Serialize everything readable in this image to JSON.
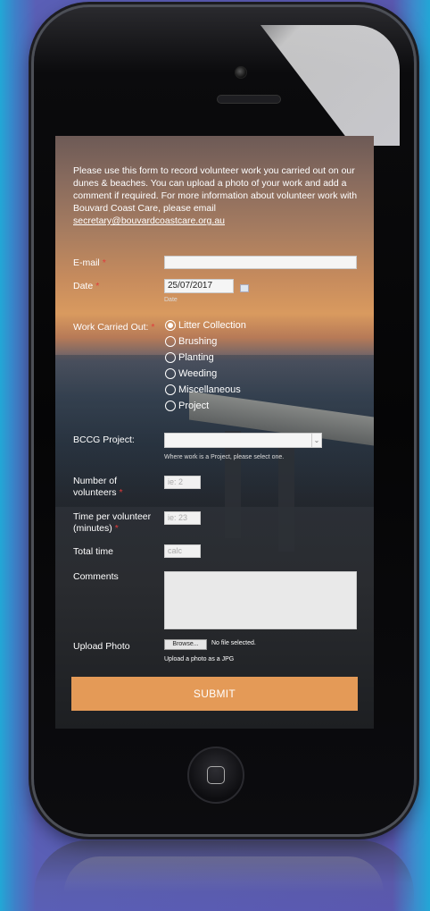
{
  "intro": {
    "text": "Please use this form to record volunteer work you carried out on our dunes & beaches. You can upload a photo of your work and add a comment if required. For more information about volunteer work with Bouvard Coast Care, please email",
    "email_link": "secretary@bouvardcoastcare.org.au"
  },
  "form": {
    "email_label": "E-mail",
    "email_value": "",
    "date_label": "Date",
    "date_value": "25/07/2017",
    "date_hint": "Date",
    "work_label": "Work Carried Out:",
    "work_options": [
      {
        "label": "Litter Collection",
        "checked": true
      },
      {
        "label": "Brushing",
        "checked": false
      },
      {
        "label": "Planting",
        "checked": false
      },
      {
        "label": "Weeding",
        "checked": false
      },
      {
        "label": "Miscellaneous",
        "checked": false
      },
      {
        "label": "Project",
        "checked": false
      }
    ],
    "project_label": "BCCG Project:",
    "project_value": "",
    "project_hint": "Where work is a Project, please select one.",
    "volunteers_label_1": "Number of",
    "volunteers_label_2": "volunteers",
    "volunteers_placeholder": "ie: 2",
    "time_label_1": "Time per volunteer",
    "time_label_2": "(minutes)",
    "time_placeholder": "ie: 23",
    "total_label": "Total time",
    "total_placeholder": "calc",
    "comments_label": "Comments",
    "upload_label": "Upload Photo",
    "browse_label": "Browse...",
    "no_file_text": "No file selected.",
    "upload_hint": "Upload a photo as a JPG",
    "submit_label": "SUBMIT"
  },
  "colors": {
    "submit_bg": "#e49a57",
    "required_marker": "#e23b3b",
    "page_bg": "#5a58b0"
  }
}
